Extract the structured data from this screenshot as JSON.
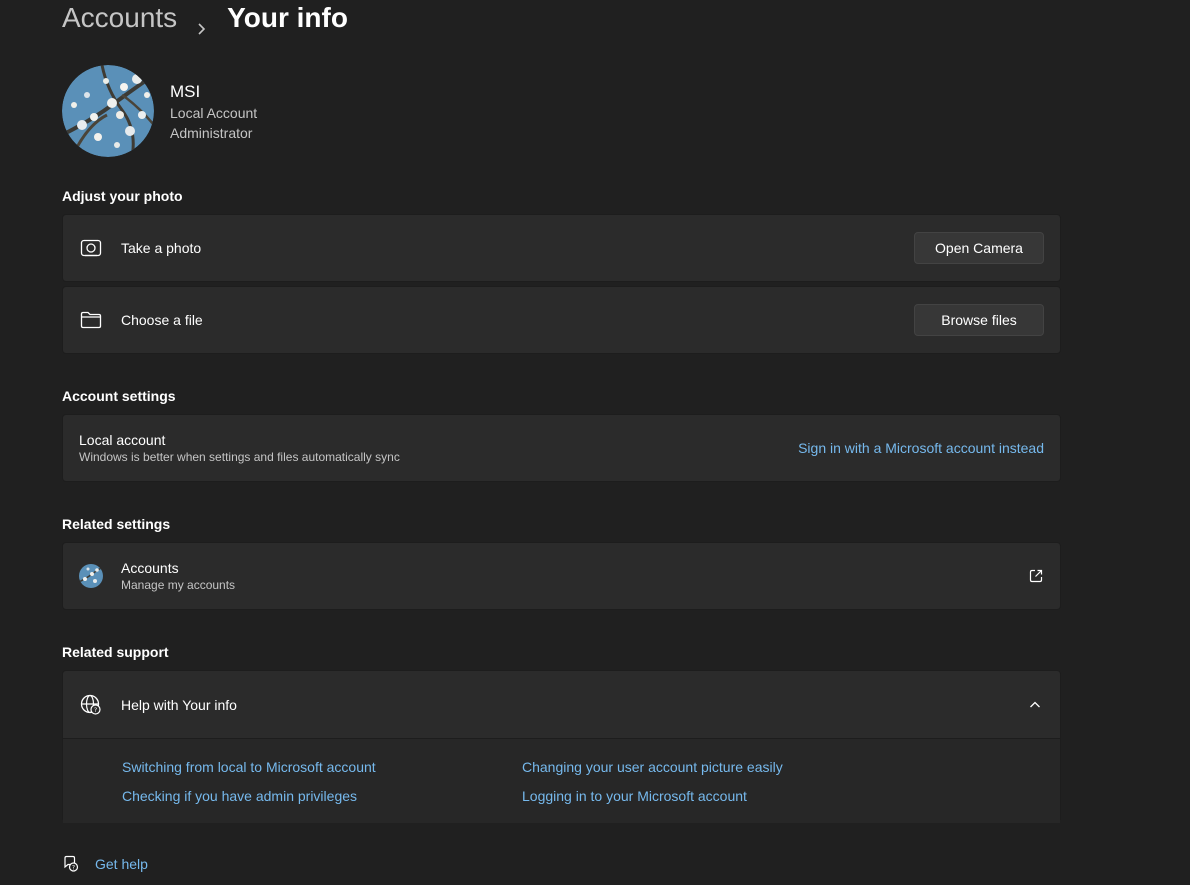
{
  "breadcrumb": {
    "parent": "Accounts",
    "current": "Your info"
  },
  "profile": {
    "name": "MSI",
    "account_type": "Local Account",
    "role": "Administrator"
  },
  "adjust_photo": {
    "title": "Adjust your photo",
    "take_photo_label": "Take a photo",
    "open_camera_label": "Open Camera",
    "choose_file_label": "Choose a file",
    "browse_files_label": "Browse files"
  },
  "account_settings": {
    "title": "Account settings",
    "local_title": "Local account",
    "local_desc": "Windows is better when settings and files automatically sync",
    "sign_in_link": "Sign in with a Microsoft account instead"
  },
  "related_settings": {
    "title": "Related settings",
    "accounts_title": "Accounts",
    "accounts_desc": "Manage my accounts"
  },
  "related_support": {
    "title": "Related support",
    "help_title": "Help with Your info",
    "links": [
      "Switching from local to Microsoft account",
      "Changing your user account picture easily",
      "Checking if you have admin privileges",
      "Logging in to your Microsoft account"
    ]
  },
  "get_help": {
    "label": "Get help"
  },
  "colors": {
    "background": "#202020",
    "card": "#2b2b2b",
    "link": "#76b9ed",
    "secondary_text": "#c5c5c5"
  },
  "icons": [
    "chevron-right-icon",
    "camera-icon",
    "folder-icon",
    "avatar-icon",
    "open-external-icon",
    "globe-help-icon",
    "chevron-up-icon",
    "get-help-icon"
  ]
}
